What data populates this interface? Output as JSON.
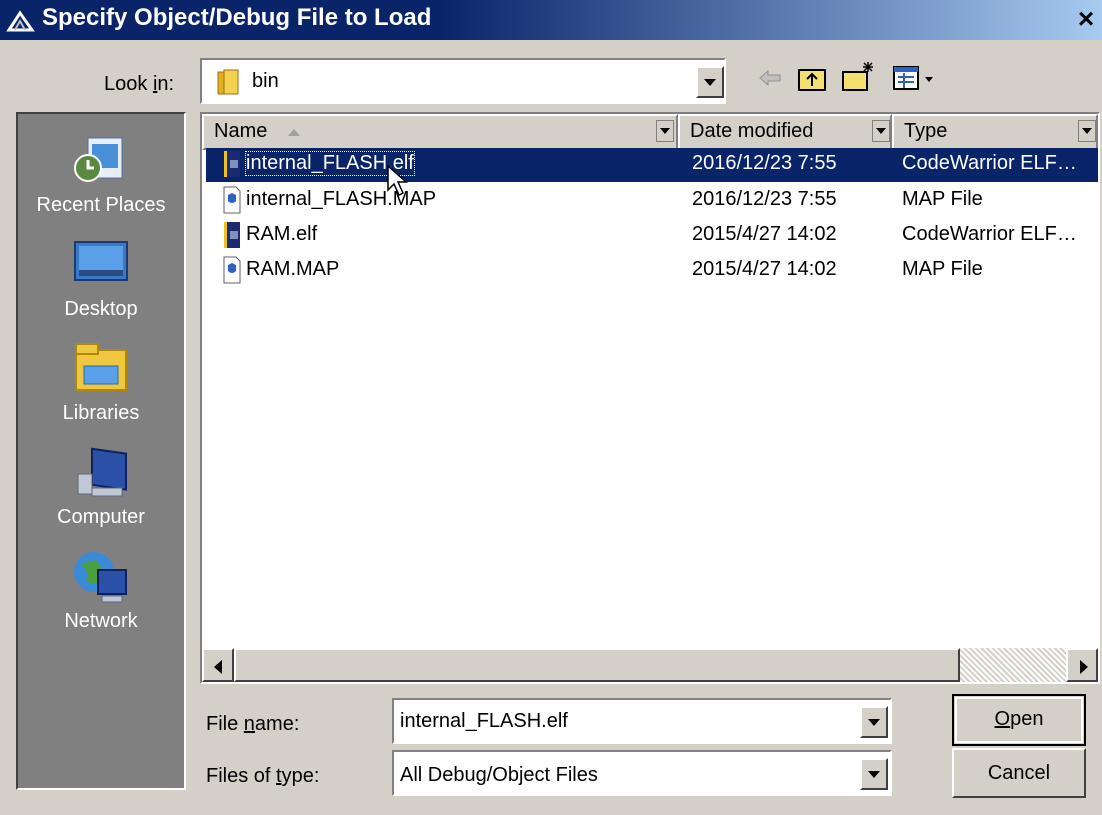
{
  "window": {
    "title": "Specify Object/Debug File to Load",
    "close_glyph": "×"
  },
  "look_in": {
    "label_pre": "Look ",
    "label_accel": "i",
    "label_post": "n:",
    "value": "bin",
    "icon": "folder-icon"
  },
  "toolbar": {
    "icons": [
      "back-arrow-icon",
      "up-folder-icon",
      "new-folder-icon",
      "view-menu-icon"
    ]
  },
  "places": [
    {
      "label": "Recent Places",
      "icon": "recent-places-icon"
    },
    {
      "label": "Desktop",
      "icon": "desktop-icon"
    },
    {
      "label": "Libraries",
      "icon": "libraries-icon"
    },
    {
      "label": "Computer",
      "icon": "computer-icon"
    },
    {
      "label": "Network",
      "icon": "network-icon"
    }
  ],
  "columns": {
    "name": "Name",
    "date": "Date modified",
    "type": "Type"
  },
  "files": [
    {
      "name": "internal_FLASH.elf",
      "date": "2016/12/23 7:55",
      "type": "CodeWarrior ELF…",
      "icon": "elf-file-icon",
      "selected": true
    },
    {
      "name": "internal_FLASH.MAP",
      "date": "2016/12/23 7:55",
      "type": "MAP File",
      "icon": "map-file-icon",
      "selected": false
    },
    {
      "name": "RAM.elf",
      "date": "2015/4/27 14:02",
      "type": "CodeWarrior ELF…",
      "icon": "elf-file-icon",
      "selected": false
    },
    {
      "name": "RAM.MAP",
      "date": "2015/4/27 14:02",
      "type": "MAP File",
      "icon": "map-file-icon",
      "selected": false
    }
  ],
  "file_name": {
    "label_pre": "File ",
    "label_accel": "n",
    "label_post": "ame:",
    "value": "internal_FLASH.elf"
  },
  "file_type": {
    "label_pre": "Files of ",
    "label_accel": "t",
    "label_post": "ype:",
    "value": "All Debug/Object Files"
  },
  "buttons": {
    "open_accel": "O",
    "open_rest": "pen",
    "cancel": "Cancel"
  },
  "colors": {
    "titlebar": "#0a246a",
    "selection": "#0a246a",
    "face": "#d4d0c8",
    "places_bg": "#808080"
  }
}
